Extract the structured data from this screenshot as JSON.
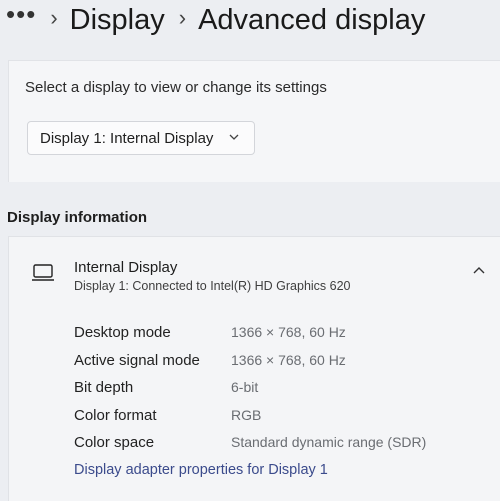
{
  "breadcrumb": {
    "more": "•••",
    "separator": "›",
    "items": [
      "Display",
      "Advanced display"
    ]
  },
  "select": {
    "label": "Select a display to view or change its settings",
    "dropdown_value": "Display 1: Internal Display",
    "dropdown_icon": "chevron-down-icon"
  },
  "section": {
    "title": "Display information"
  },
  "display": {
    "icon": "monitor-icon",
    "name": "Internal Display",
    "subtitle": "Display 1: Connected to Intel(R) HD Graphics 620",
    "expand_icon": "chevron-up-icon",
    "properties": [
      {
        "label": "Desktop mode",
        "value": "1366 × 768, 60 Hz"
      },
      {
        "label": "Active signal mode",
        "value": "1366 × 768, 60 Hz"
      },
      {
        "label": "Bit depth",
        "value": "6-bit"
      },
      {
        "label": "Color format",
        "value": "RGB"
      },
      {
        "label": "Color space",
        "value": "Standard dynamic range (SDR)"
      }
    ],
    "adapter_link": "Display adapter properties for Display 1"
  },
  "colors": {
    "background": "#eceef2",
    "card": "#f4f5f7",
    "link": "#3b4b8c",
    "value_text": "#6a6d72"
  }
}
